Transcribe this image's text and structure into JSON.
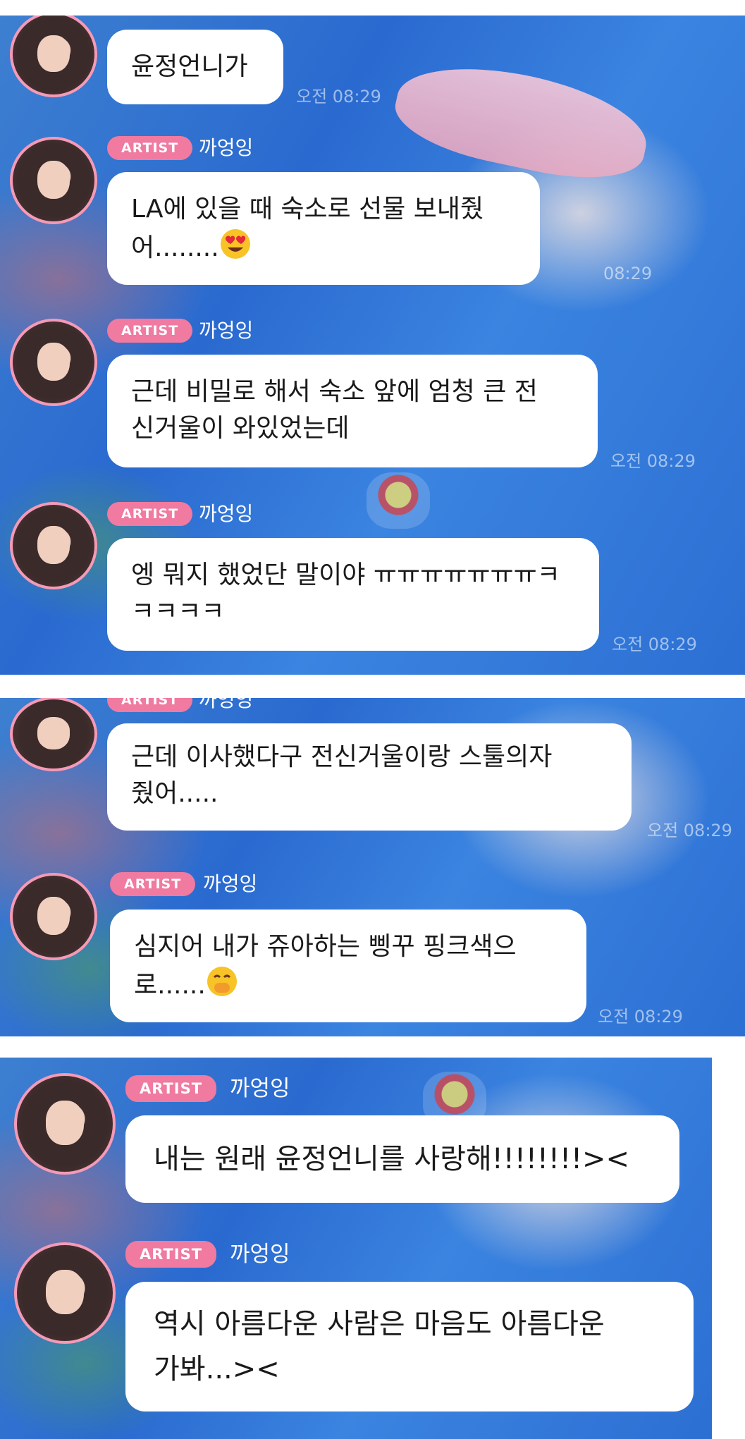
{
  "sender": {
    "badge": "ARTIST",
    "name": "까엉잉"
  },
  "colors": {
    "badge": "#f07aa0",
    "avatar_ring": "#f59ab6",
    "bubble": "#ffffff"
  },
  "panel1": {
    "messages": [
      {
        "text": "윤정언니가",
        "time": "오전 08:29"
      },
      {
        "text": "LA에 있을 때 숙소로 선물 보내줬\n어........",
        "emoji": "smiling-face-with-heart-eyes",
        "time": "08:29"
      },
      {
        "text": "근데 비밀로 해서 숙소 앞에 엄청 큰 전\n신거울이 와있었는데",
        "time": "오전 08:29"
      },
      {
        "text": "엥 뭐지 했었단 말이야 ㅠㅠㅠㅠㅠㅠㅠㅋ\nㅋㅋㅋㅋ",
        "time": "오전 08:29"
      }
    ]
  },
  "panel2": {
    "messages": [
      {
        "text": "근데 이사했다구 전신거울이랑 스툴의자\n줬어.....",
        "time": "오전 08:29"
      },
      {
        "text": "심지어 내가 쥬아하는 삥꾸 핑크색으\n로......",
        "emoji": "face-with-hand-over-mouth",
        "time": "오전 08:29"
      }
    ]
  },
  "panel3": {
    "messages": [
      {
        "text": "내는 원래 윤정언니를 사랑해!!!!!!!!><"
      },
      {
        "text": "역시 아름다운 사람은 마음도 아름다운\n가봐...><"
      }
    ]
  }
}
